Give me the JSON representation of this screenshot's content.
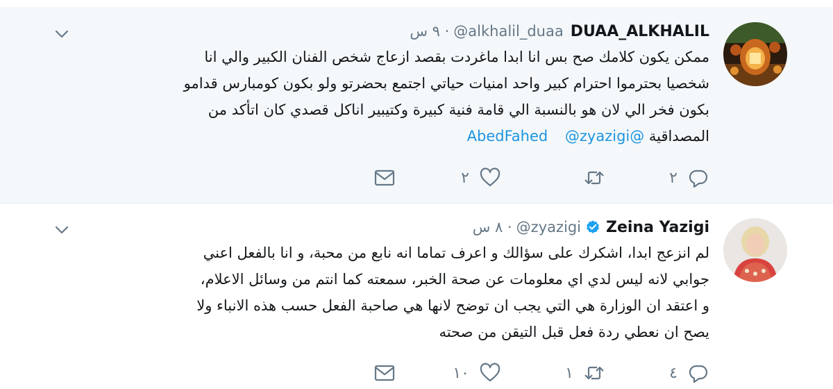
{
  "tweets": [
    {
      "display_name": "DUAA_ALKHALIL",
      "handle": "@alkhalil_duaa",
      "time": "· ٩ س",
      "verified": false,
      "lines": [
        "ممكن يكون كلامك صح بس انا ابدا ماغردت بقصد ازعاج شخص الفنان الكبير والي انا",
        "شخصيا بحترموا احترام كبير واحد امنيات حياتي اجتمع بحضرتو ولو بكون كومبارس قدامو",
        "بكون فخر الي لان هو بالنسبة الي قامة فنية كبيرة وكتيبير اناكل قصدي كان اتأكد من"
      ],
      "last_line_text": "المصداقية",
      "mentions": [
        "@AbedFahed",
        "@zyazigi"
      ],
      "replies": "٢",
      "retweets": "",
      "likes": "٢",
      "avatar_icon": "lantern-avatar-image"
    },
    {
      "display_name": "Zeina Yazigi",
      "handle": "@zyazigi",
      "time": "· ٨ س",
      "verified": true,
      "lines": [
        "لم انزعج ابدا، اشكرك على سؤالك و اعرف تماما انه نابع من محبة، و انا بالفعل اعني",
        "جوابي لانه ليس لدي اي معلومات عن صحة الخبر، سمعته كما انتم من وسائل الاعلام،",
        "و اعتقد ان الوزارة هي التي يجب ان توضح لانها هي صاحبة الفعل حسب هذه الانباء ولا",
        "يصح ان نعطي ردة فعل قبل التيقن من صحته"
      ],
      "replies": "٤",
      "retweets": "١",
      "likes": "١٠",
      "avatar_icon": "woman-portrait-avatar"
    }
  ],
  "icons": {
    "reply": "reply-icon",
    "retweet": "retweet-icon",
    "like": "heart-icon",
    "dm": "envelope-icon",
    "more": "chevron-down-icon",
    "verified": "verified-badge-icon"
  },
  "colors": {
    "link": "#1b95e0",
    "muted": "#657786",
    "thread_line": "#9fd0f5",
    "highlight_bg": "#f5f8fa",
    "verified": "#1da1f2"
  }
}
